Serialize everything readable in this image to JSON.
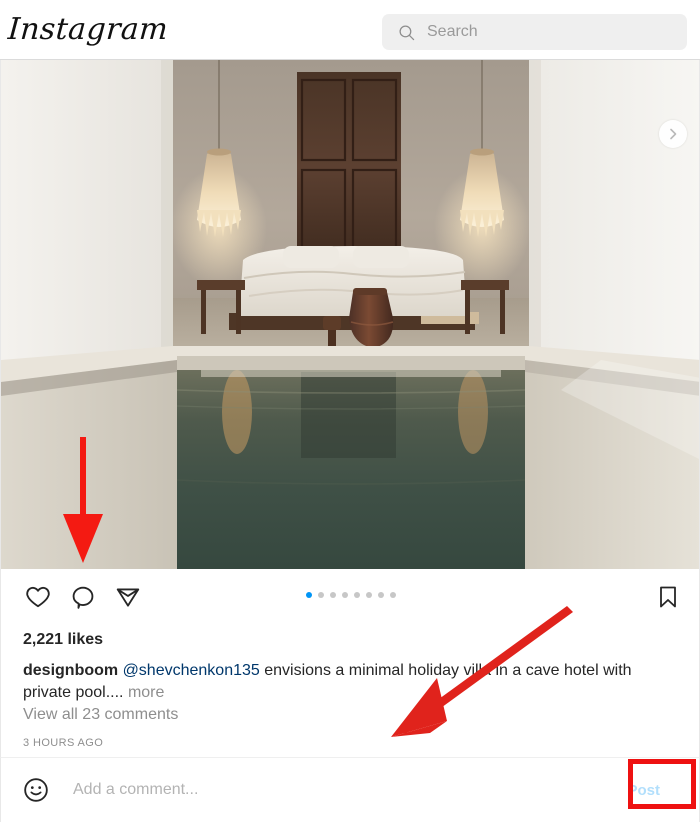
{
  "app": {
    "brand": "Instagram"
  },
  "header": {
    "search": {
      "icon": "search-icon",
      "placeholder": "Search",
      "value": ""
    }
  },
  "post": {
    "media": {
      "alt": "Minimal cave-hotel villa bedroom with dark wooden door, two straw pendant lamps, white bed, clay urn and a long green private pool",
      "carousel": {
        "total_dots": 8,
        "active_index": 0,
        "next_icon": "chevron-right-icon"
      }
    },
    "actions": {
      "like_icon": "heart-icon",
      "comment_icon": "comment-bubble-icon",
      "share_icon": "share-paper-plane-icon",
      "save_icon": "bookmark-icon"
    },
    "likes": "2,221 likes",
    "caption": {
      "username": "designboom",
      "mention": "@shevchenkon135",
      "text": " envisions a minimal holiday villa in a cave hotel with private pool....",
      "more": "more"
    },
    "view_comments": "View all 23 comments",
    "timestamp": "3 HOURS AGO"
  },
  "comment_bar": {
    "emoji_icon": "smiley-face-icon",
    "input_placeholder": "Add a comment...",
    "input_value": "",
    "post_label": "Post"
  },
  "annotations": {
    "arrow_down_target": "comment-bubble-icon",
    "arrow_diagonal_target": "post-button",
    "highlight_target": "post-button",
    "color": "#ee1111"
  },
  "colors": {
    "accent_blue": "#0095f6",
    "post_blue": "#b2dffc",
    "link_blue": "#00376b",
    "muted_gray": "#8e8e8e",
    "text": "#262626",
    "search_bg": "#efefef",
    "annotation_red": "#ee1111"
  }
}
